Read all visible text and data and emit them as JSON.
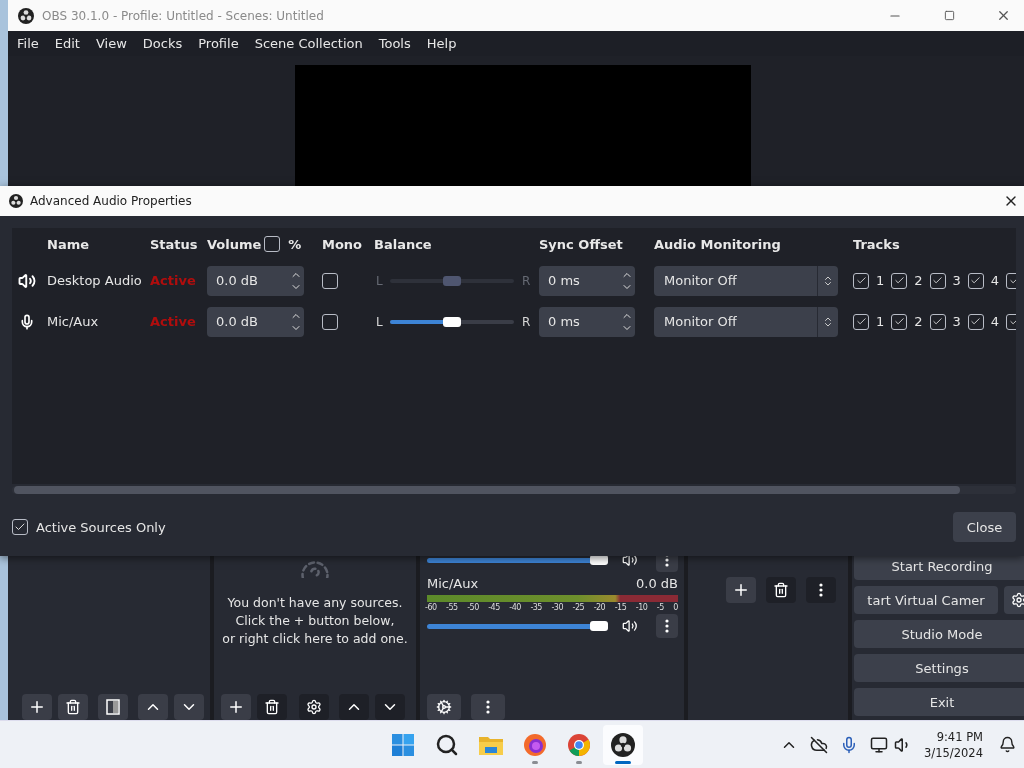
{
  "main_window": {
    "title": "OBS 30.1.0 - Profile: Untitled - Scenes: Untitled",
    "menu": [
      "File",
      "Edit",
      "View",
      "Docks",
      "Profile",
      "Scene Collection",
      "Tools",
      "Help"
    ]
  },
  "sources_dock": {
    "empty_message": "You don't have any sources.\nClick the + button below,\nor right click here to add one."
  },
  "mixer": {
    "channels": [
      {
        "level": 1
      },
      {
        "name": "Mic/Aux",
        "reading": "0.0 dB",
        "level": 1
      }
    ],
    "scale": [
      "-60",
      "-55",
      "-50",
      "-45",
      "-40",
      "-35",
      "-30",
      "-25",
      "-20",
      "-15",
      "-10",
      "-5",
      "0"
    ]
  },
  "controls": [
    {
      "label": "Start Recording",
      "kind": "button"
    },
    {
      "label": "tart Virtual Camer",
      "kind": "button_with_settings"
    },
    {
      "label": "Studio Mode",
      "kind": "button"
    },
    {
      "label": "Settings",
      "kind": "button"
    },
    {
      "label": "Exit",
      "kind": "button"
    }
  ],
  "dialog": {
    "title": "Advanced Audio Properties",
    "columns": {
      "name": "Name",
      "status": "Status",
      "volume": "Volume",
      "volume_percent": {
        "label": "%",
        "checked": false
      },
      "mono": "Mono",
      "balance": "Balance",
      "sync_offset": "Sync Offset",
      "monitoring": "Audio Monitoring",
      "tracks": "Tracks"
    },
    "sources": [
      {
        "name": "Desktop Audio",
        "kind": "speaker",
        "status": "Active",
        "volume": "0.0 dB",
        "mono": false,
        "balance": {
          "left": "L",
          "right": "R",
          "level": 0.5,
          "disabled": true
        },
        "sync_offset": "0 ms",
        "monitoring": "Monitor Off",
        "tracks": [
          {
            "label": "1",
            "checked": true
          },
          {
            "label": "2",
            "checked": true
          },
          {
            "label": "3",
            "checked": true
          },
          {
            "label": "4",
            "checked": true
          },
          {
            "checked": true
          }
        ]
      },
      {
        "name": "Mic/Aux",
        "kind": "mic",
        "status": "Active",
        "volume": "0.0 dB",
        "mono": false,
        "balance": {
          "left": "L",
          "right": "R",
          "level": 0.5,
          "disabled": false
        },
        "sync_offset": "0 ms",
        "monitoring": "Monitor Off",
        "tracks": [
          {
            "label": "1",
            "checked": true
          },
          {
            "label": "2",
            "checked": true
          },
          {
            "label": "3",
            "checked": true
          },
          {
            "label": "4",
            "checked": true
          },
          {
            "checked": true
          }
        ]
      }
    ],
    "active_sources_only": {
      "label": "Active Sources Only",
      "checked": true
    },
    "close_button": "Close"
  },
  "taskbar": {
    "apps": [
      {
        "kind": "windows",
        "running": false,
        "selected": false
      },
      {
        "kind": "search",
        "running": false,
        "selected": false
      },
      {
        "kind": "folder",
        "running": false,
        "selected": false
      },
      {
        "kind": "firefox",
        "running": true,
        "selected": false
      },
      {
        "kind": "chrome",
        "running": true,
        "selected": false
      },
      {
        "kind": "obs",
        "running": true,
        "selected": true
      }
    ],
    "time": "9:41 PM",
    "date": "3/15/2024"
  }
}
